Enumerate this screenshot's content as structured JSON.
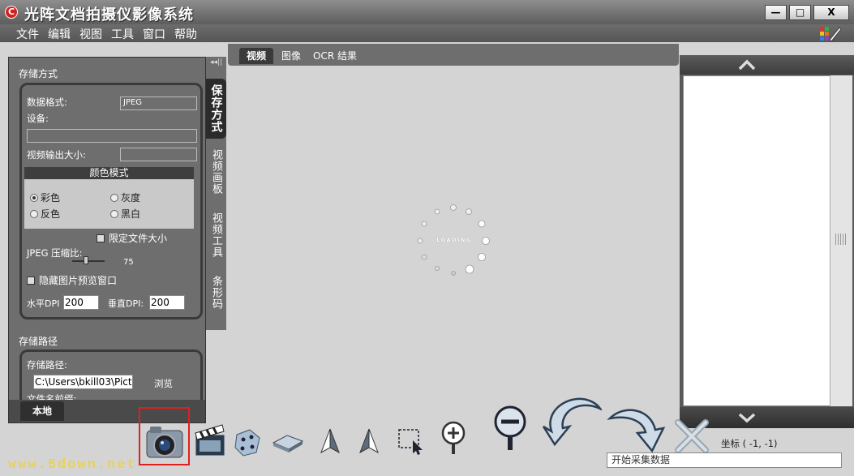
{
  "window": {
    "title": "光阵文档拍摄仪影像系统",
    "app_icon_glyph": "C"
  },
  "titlebar_buttons": {
    "minimize": "—",
    "maximize": "□",
    "close": "X"
  },
  "menu": [
    "文件",
    "编辑",
    "视图",
    "工具",
    "窗口",
    "帮助"
  ],
  "left_panel": {
    "storage_mode_label": "存储方式",
    "data_format_label": "数据格式:",
    "data_format_value": "JPEG",
    "device_label": "设备:",
    "video_output_label": "视频输出大小:",
    "color_mode_header": "颜色模式",
    "radios": {
      "color": "彩色",
      "gray": "灰度",
      "invert": "反色",
      "bw": "黑白"
    },
    "limit_size_label": "限定文件大小",
    "jpeg_compress_label": "JPEG 压缩比:",
    "jpeg_compress_value": "75",
    "hide_preview_label": "隐藏图片预览窗口",
    "dpi_h_label": "水平DPI",
    "dpi_h_value": "200",
    "dpi_v_label": "垂直DPI:",
    "dpi_v_value": "200",
    "storage_path_section": "存储路径",
    "storage_path_label": "存储路径:",
    "storage_path_value": "C:\\Users\\bkill03\\Pict",
    "browse_label": "浏览",
    "filename_prefix_label": "文件名前缀:",
    "bottom_tab": "本地"
  },
  "side_tabs": {
    "collapse": "◂◂||",
    "items": [
      "保存方式",
      "视频画板",
      "视频工具",
      "条形码"
    ]
  },
  "main_tabs": [
    "视频",
    "图像",
    "OCR 结果"
  ],
  "loading_text": "LOADING",
  "coords_text": "坐标 ( -1, -1)",
  "status_text": "开始采集数据",
  "watermark": "www.5down.net",
  "highlight_color": "#e02020"
}
